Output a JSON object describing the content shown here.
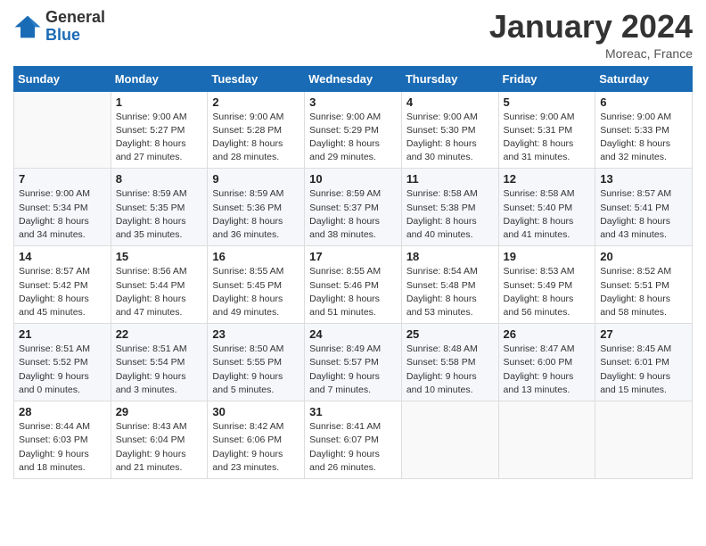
{
  "logo": {
    "general": "General",
    "blue": "Blue"
  },
  "header": {
    "title": "January 2024",
    "location": "Moreac, France"
  },
  "days": [
    "Sunday",
    "Monday",
    "Tuesday",
    "Wednesday",
    "Thursday",
    "Friday",
    "Saturday"
  ],
  "weeks": [
    [
      {
        "day": "",
        "sunrise": "",
        "sunset": "",
        "daylight": ""
      },
      {
        "day": "1",
        "sunrise": "Sunrise: 9:00 AM",
        "sunset": "Sunset: 5:27 PM",
        "daylight": "Daylight: 8 hours and 27 minutes."
      },
      {
        "day": "2",
        "sunrise": "Sunrise: 9:00 AM",
        "sunset": "Sunset: 5:28 PM",
        "daylight": "Daylight: 8 hours and 28 minutes."
      },
      {
        "day": "3",
        "sunrise": "Sunrise: 9:00 AM",
        "sunset": "Sunset: 5:29 PM",
        "daylight": "Daylight: 8 hours and 29 minutes."
      },
      {
        "day": "4",
        "sunrise": "Sunrise: 9:00 AM",
        "sunset": "Sunset: 5:30 PM",
        "daylight": "Daylight: 8 hours and 30 minutes."
      },
      {
        "day": "5",
        "sunrise": "Sunrise: 9:00 AM",
        "sunset": "Sunset: 5:31 PM",
        "daylight": "Daylight: 8 hours and 31 minutes."
      },
      {
        "day": "6",
        "sunrise": "Sunrise: 9:00 AM",
        "sunset": "Sunset: 5:33 PM",
        "daylight": "Daylight: 8 hours and 32 minutes."
      }
    ],
    [
      {
        "day": "7",
        "sunrise": "Sunrise: 9:00 AM",
        "sunset": "Sunset: 5:34 PM",
        "daylight": "Daylight: 8 hours and 34 minutes."
      },
      {
        "day": "8",
        "sunrise": "Sunrise: 8:59 AM",
        "sunset": "Sunset: 5:35 PM",
        "daylight": "Daylight: 8 hours and 35 minutes."
      },
      {
        "day": "9",
        "sunrise": "Sunrise: 8:59 AM",
        "sunset": "Sunset: 5:36 PM",
        "daylight": "Daylight: 8 hours and 36 minutes."
      },
      {
        "day": "10",
        "sunrise": "Sunrise: 8:59 AM",
        "sunset": "Sunset: 5:37 PM",
        "daylight": "Daylight: 8 hours and 38 minutes."
      },
      {
        "day": "11",
        "sunrise": "Sunrise: 8:58 AM",
        "sunset": "Sunset: 5:38 PM",
        "daylight": "Daylight: 8 hours and 40 minutes."
      },
      {
        "day": "12",
        "sunrise": "Sunrise: 8:58 AM",
        "sunset": "Sunset: 5:40 PM",
        "daylight": "Daylight: 8 hours and 41 minutes."
      },
      {
        "day": "13",
        "sunrise": "Sunrise: 8:57 AM",
        "sunset": "Sunset: 5:41 PM",
        "daylight": "Daylight: 8 hours and 43 minutes."
      }
    ],
    [
      {
        "day": "14",
        "sunrise": "Sunrise: 8:57 AM",
        "sunset": "Sunset: 5:42 PM",
        "daylight": "Daylight: 8 hours and 45 minutes."
      },
      {
        "day": "15",
        "sunrise": "Sunrise: 8:56 AM",
        "sunset": "Sunset: 5:44 PM",
        "daylight": "Daylight: 8 hours and 47 minutes."
      },
      {
        "day": "16",
        "sunrise": "Sunrise: 8:55 AM",
        "sunset": "Sunset: 5:45 PM",
        "daylight": "Daylight: 8 hours and 49 minutes."
      },
      {
        "day": "17",
        "sunrise": "Sunrise: 8:55 AM",
        "sunset": "Sunset: 5:46 PM",
        "daylight": "Daylight: 8 hours and 51 minutes."
      },
      {
        "day": "18",
        "sunrise": "Sunrise: 8:54 AM",
        "sunset": "Sunset: 5:48 PM",
        "daylight": "Daylight: 8 hours and 53 minutes."
      },
      {
        "day": "19",
        "sunrise": "Sunrise: 8:53 AM",
        "sunset": "Sunset: 5:49 PM",
        "daylight": "Daylight: 8 hours and 56 minutes."
      },
      {
        "day": "20",
        "sunrise": "Sunrise: 8:52 AM",
        "sunset": "Sunset: 5:51 PM",
        "daylight": "Daylight: 8 hours and 58 minutes."
      }
    ],
    [
      {
        "day": "21",
        "sunrise": "Sunrise: 8:51 AM",
        "sunset": "Sunset: 5:52 PM",
        "daylight": "Daylight: 9 hours and 0 minutes."
      },
      {
        "day": "22",
        "sunrise": "Sunrise: 8:51 AM",
        "sunset": "Sunset: 5:54 PM",
        "daylight": "Daylight: 9 hours and 3 minutes."
      },
      {
        "day": "23",
        "sunrise": "Sunrise: 8:50 AM",
        "sunset": "Sunset: 5:55 PM",
        "daylight": "Daylight: 9 hours and 5 minutes."
      },
      {
        "day": "24",
        "sunrise": "Sunrise: 8:49 AM",
        "sunset": "Sunset: 5:57 PM",
        "daylight": "Daylight: 9 hours and 7 minutes."
      },
      {
        "day": "25",
        "sunrise": "Sunrise: 8:48 AM",
        "sunset": "Sunset: 5:58 PM",
        "daylight": "Daylight: 9 hours and 10 minutes."
      },
      {
        "day": "26",
        "sunrise": "Sunrise: 8:47 AM",
        "sunset": "Sunset: 6:00 PM",
        "daylight": "Daylight: 9 hours and 13 minutes."
      },
      {
        "day": "27",
        "sunrise": "Sunrise: 8:45 AM",
        "sunset": "Sunset: 6:01 PM",
        "daylight": "Daylight: 9 hours and 15 minutes."
      }
    ],
    [
      {
        "day": "28",
        "sunrise": "Sunrise: 8:44 AM",
        "sunset": "Sunset: 6:03 PM",
        "daylight": "Daylight: 9 hours and 18 minutes."
      },
      {
        "day": "29",
        "sunrise": "Sunrise: 8:43 AM",
        "sunset": "Sunset: 6:04 PM",
        "daylight": "Daylight: 9 hours and 21 minutes."
      },
      {
        "day": "30",
        "sunrise": "Sunrise: 8:42 AM",
        "sunset": "Sunset: 6:06 PM",
        "daylight": "Daylight: 9 hours and 23 minutes."
      },
      {
        "day": "31",
        "sunrise": "Sunrise: 8:41 AM",
        "sunset": "Sunset: 6:07 PM",
        "daylight": "Daylight: 9 hours and 26 minutes."
      },
      {
        "day": "",
        "sunrise": "",
        "sunset": "",
        "daylight": ""
      },
      {
        "day": "",
        "sunrise": "",
        "sunset": "",
        "daylight": ""
      },
      {
        "day": "",
        "sunrise": "",
        "sunset": "",
        "daylight": ""
      }
    ]
  ]
}
